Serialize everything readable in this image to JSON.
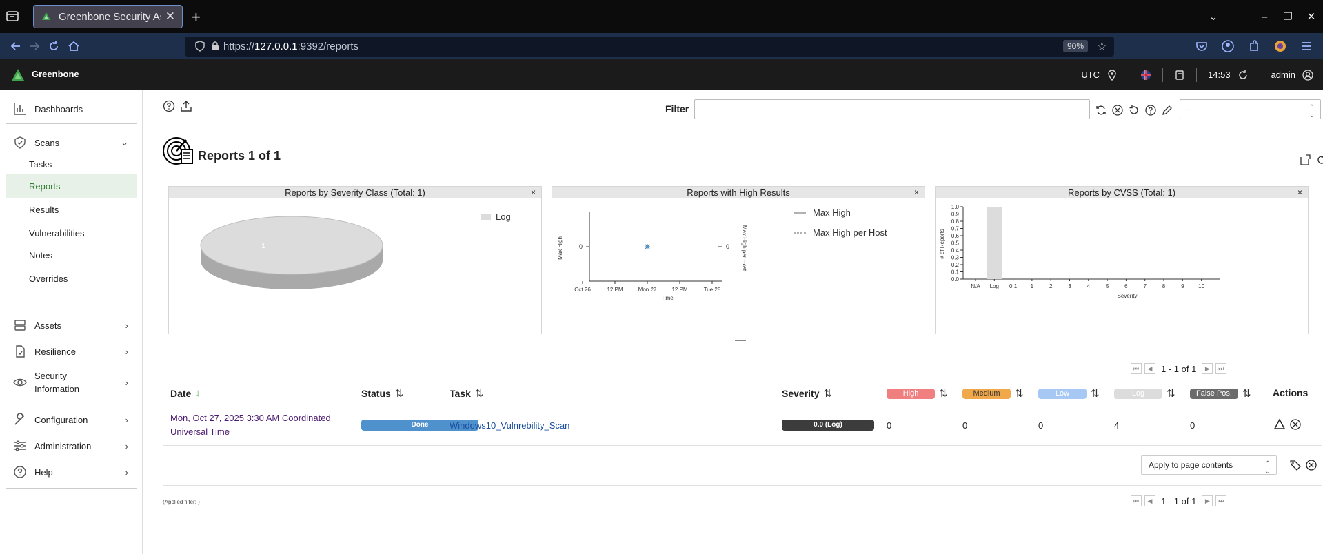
{
  "browser": {
    "tab_title": "Greenbone Security Assis",
    "url_prefix": "https://",
    "url_host": "127.0.0.1",
    "url_rest": ":9392/reports",
    "zoom": "90%"
  },
  "header": {
    "brand": "Greenbone",
    "timezone": "UTC",
    "time": "14:53",
    "user": "admin"
  },
  "sidebar": {
    "dashboards": "Dashboards",
    "scans": "Scans",
    "scans_items": [
      "Tasks",
      "Reports",
      "Results",
      "Vulnerabilities",
      "Notes",
      "Overrides"
    ],
    "assets": "Assets",
    "resilience": "Resilience",
    "security_info_1": "Security",
    "security_info_2": "Information",
    "configuration": "Configuration",
    "administration": "Administration",
    "help": "Help"
  },
  "filter": {
    "label": "Filter",
    "value": "",
    "select_value": "--"
  },
  "page": {
    "title": "Reports 1 of 1"
  },
  "charts": {
    "severity_class": {
      "title": "Reports by Severity Class (Total: 1)",
      "close": "×",
      "legend": "Log",
      "slice_label": "1"
    },
    "high_results": {
      "title": "Reports with High Results",
      "close": "×",
      "legend_max_high": "Max High",
      "legend_max_high_per_host": "Max High per Host",
      "ylabel_left": "Max High",
      "ylabel_right": "Max High per Host",
      "xlabel": "Time",
      "x_ticks": [
        "Oct 26",
        "12 PM",
        "Mon 27",
        "12 PM",
        "Tue 28"
      ],
      "y_tick_left": "0",
      "y_tick_right": "0"
    },
    "cvss": {
      "title": "Reports by CVSS (Total: 1)",
      "close": "×",
      "ylabel": "# of Reports",
      "xlabel": "Severity"
    }
  },
  "chart_data": [
    {
      "type": "pie",
      "title": "Reports by Severity Class (Total: 1)",
      "categories": [
        "Log"
      ],
      "values": [
        1
      ],
      "colors": [
        "#dcdcdc"
      ]
    },
    {
      "type": "line",
      "title": "Reports with High Results",
      "xlabel": "Time",
      "ylabel": "Max High",
      "x_ticks": [
        "Oct 26",
        "12 PM",
        "Mon 27",
        "12 PM",
        "Tue 28"
      ],
      "series": [
        {
          "name": "Max High",
          "x": [
            "Mon 27"
          ],
          "values": [
            0
          ]
        },
        {
          "name": "Max High per Host",
          "x": [
            "Mon 27"
          ],
          "values": [
            0
          ]
        }
      ]
    },
    {
      "type": "bar",
      "title": "Reports by CVSS (Total: 1)",
      "xlabel": "Severity",
      "ylabel": "# of Reports",
      "categories": [
        "N/A",
        "Log",
        "0.1",
        "1",
        "2",
        "3",
        "4",
        "5",
        "6",
        "7",
        "8",
        "9",
        "10"
      ],
      "values": [
        0,
        1,
        0,
        0,
        0,
        0,
        0,
        0,
        0,
        0,
        0,
        0,
        0
      ],
      "y_ticks": [
        "0.0",
        "0.1",
        "0.2",
        "0.3",
        "0.4",
        "0.5",
        "0.6",
        "0.7",
        "0.8",
        "0.9",
        "1.0"
      ],
      "ylim": [
        0,
        1.0
      ],
      "bar_color": "#dcdcdc"
    }
  ],
  "pagination": {
    "text": "1 - 1 of 1"
  },
  "table": {
    "headers": {
      "date": "Date",
      "status": "Status",
      "task": "Task",
      "severity": "Severity",
      "high": "High",
      "medium": "Medium",
      "low": "Low",
      "log": "Log",
      "false_pos": "False Pos.",
      "actions": "Actions"
    },
    "badge_colors": {
      "high": "#f08080",
      "medium": "#f0a84a",
      "low": "#a6c8f2",
      "log": "#dcdcdc",
      "false_pos": "#6b6b6b"
    },
    "rows": [
      {
        "date_line1": "Mon, Oct 27, 2025 3:30 AM Coordinated",
        "date_line2": "Universal Time",
        "status": "Done",
        "task": "Windows10_Vulnrebility_Scan",
        "severity": "0.0 (Log)",
        "high": "0",
        "medium": "0",
        "low": "0",
        "log": "4",
        "false_pos": "0"
      }
    ]
  },
  "bulk": {
    "apply_select": "Apply to page contents"
  },
  "footer": {
    "applied_filter": "(Applied filter: )"
  }
}
